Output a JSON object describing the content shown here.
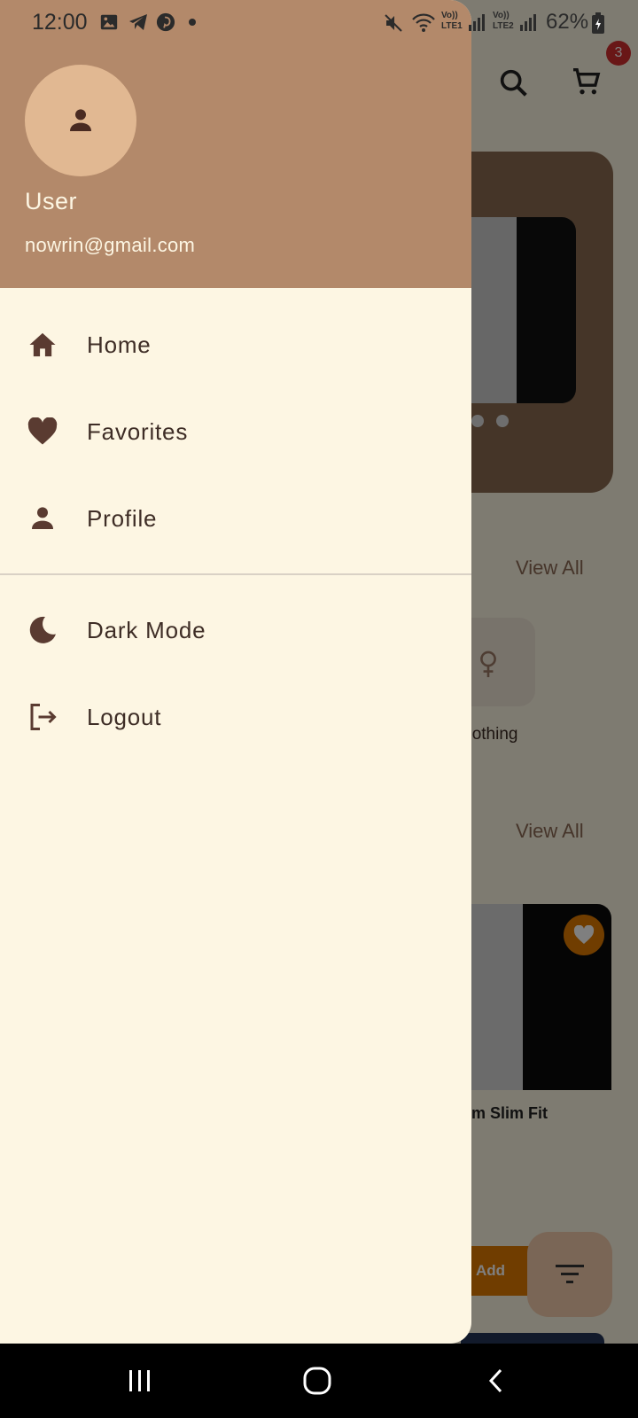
{
  "status_bar": {
    "time": "12:00",
    "battery": "62%",
    "sim1": "Vo)) LTE1",
    "sim2": "Vo)) LTE2"
  },
  "background": {
    "cart_badge": "3",
    "view_all_1": "View All",
    "view_all_2": "View All",
    "category_label": "n's clothing",
    "product_title": "emium Slim Fit",
    "add_label": "Add"
  },
  "drawer": {
    "user_name": "User",
    "user_email": "nowrin@gmail.com",
    "items": [
      {
        "label": "Home",
        "icon": "home-icon"
      },
      {
        "label": "Favorites",
        "icon": "heart-icon"
      },
      {
        "label": "Profile",
        "icon": "person-icon"
      },
      {
        "label": "Dark Mode",
        "icon": "moon-icon"
      },
      {
        "label": "Logout",
        "icon": "logout-icon"
      }
    ]
  },
  "colors": {
    "header": "#b3896a",
    "drawer_bg": "#fdf6e3",
    "text": "#3e2d26",
    "accent": "#e07b00"
  }
}
